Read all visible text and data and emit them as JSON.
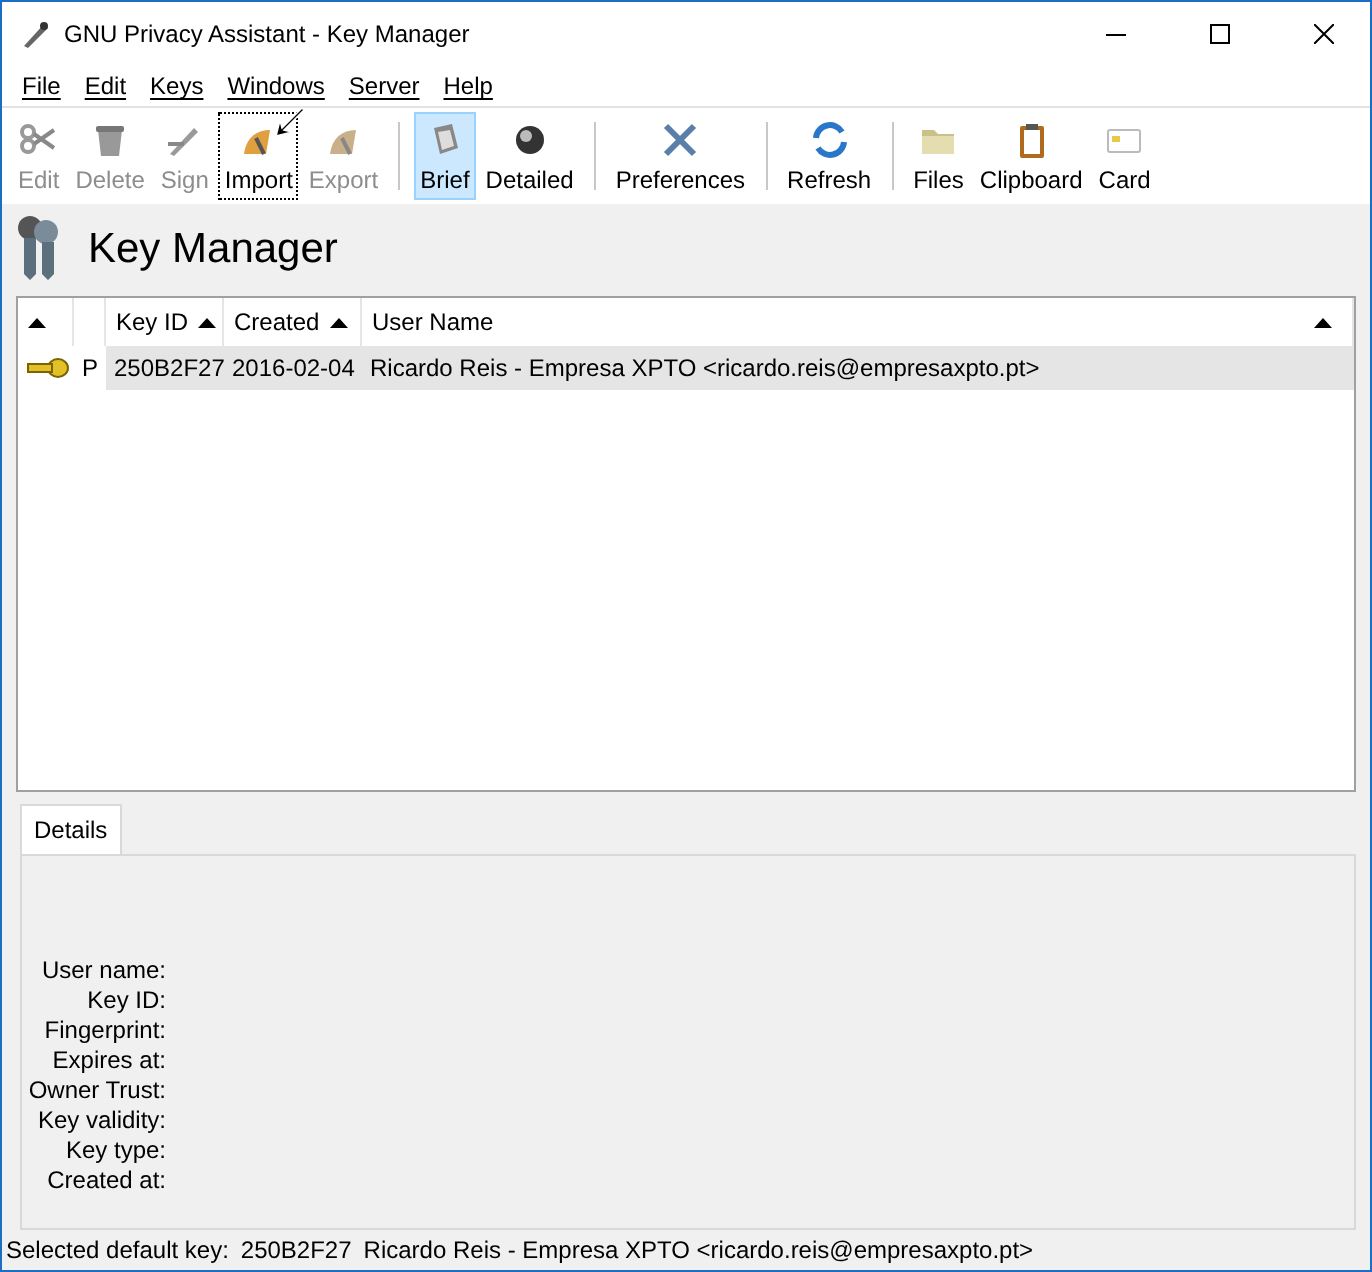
{
  "window": {
    "title": "GNU Privacy Assistant - Key Manager"
  },
  "menu": [
    {
      "label": "File",
      "selected": false
    },
    {
      "label": "Edit",
      "selected": false
    },
    {
      "label": "Keys",
      "selected": false
    },
    {
      "label": "Windows",
      "selected": false
    },
    {
      "label": "Server",
      "selected": false
    },
    {
      "label": "Help",
      "selected": false
    }
  ],
  "toolbar": [
    [
      {
        "label": "Edit",
        "kind": "edit",
        "disabled": true,
        "selected": false,
        "focused": false
      },
      {
        "label": "Delete",
        "kind": "delete",
        "disabled": true,
        "selected": false,
        "focused": false
      },
      {
        "label": "Sign",
        "kind": "sign",
        "disabled": true,
        "selected": false,
        "focused": false
      },
      {
        "label": "Import",
        "kind": "import",
        "disabled": false,
        "selected": false,
        "focused": true
      },
      {
        "label": "Export",
        "kind": "export",
        "disabled": true,
        "selected": false,
        "focused": false
      }
    ],
    [
      {
        "label": "Brief",
        "kind": "brief",
        "disabled": false,
        "selected": true,
        "focused": false
      },
      {
        "label": "Detailed",
        "kind": "detailed",
        "disabled": false,
        "selected": false,
        "focused": false
      }
    ],
    [
      {
        "label": "Preferences",
        "kind": "preferences",
        "disabled": false,
        "selected": false,
        "focused": false
      }
    ],
    [
      {
        "label": "Refresh",
        "kind": "refresh",
        "disabled": false,
        "selected": false,
        "focused": false
      }
    ],
    [
      {
        "label": "Files",
        "kind": "files",
        "disabled": false,
        "selected": false,
        "focused": false
      },
      {
        "label": "Clipboard",
        "kind": "clipboard",
        "disabled": false,
        "selected": false,
        "focused": false
      },
      {
        "label": "Card",
        "kind": "card",
        "disabled": false,
        "selected": false,
        "focused": false
      }
    ]
  ],
  "heading": "Key Manager",
  "table": {
    "columns": [
      {
        "sorted": true
      },
      {
        "sorted": false
      },
      {
        "label": "Key ID",
        "sorted": true
      },
      {
        "label": "Created",
        "sorted": true
      },
      {
        "label": "User Name",
        "sorted": true
      }
    ],
    "rows": [
      {
        "type": "P",
        "key_id": "250B2F27",
        "created": "2016-02-04",
        "user_name": "Ricardo Reis - Empresa XPTO <ricardo.reis@empresaxpto.pt>",
        "selected": true
      }
    ]
  },
  "details": {
    "tabs": [
      {
        "label": "Details",
        "selected": true
      }
    ],
    "fields": [
      "User name:",
      "Key ID:",
      "Fingerprint:",
      "Expires at:",
      "Owner Trust:",
      "Key validity:",
      "Key type:",
      "Created at:"
    ]
  },
  "status_bar": {
    "label": "Selected default key:",
    "key_id": "250B2F27",
    "user_name": "Ricardo Reis - Empresa XPTO <ricardo.reis@empresaxpto.pt>"
  }
}
